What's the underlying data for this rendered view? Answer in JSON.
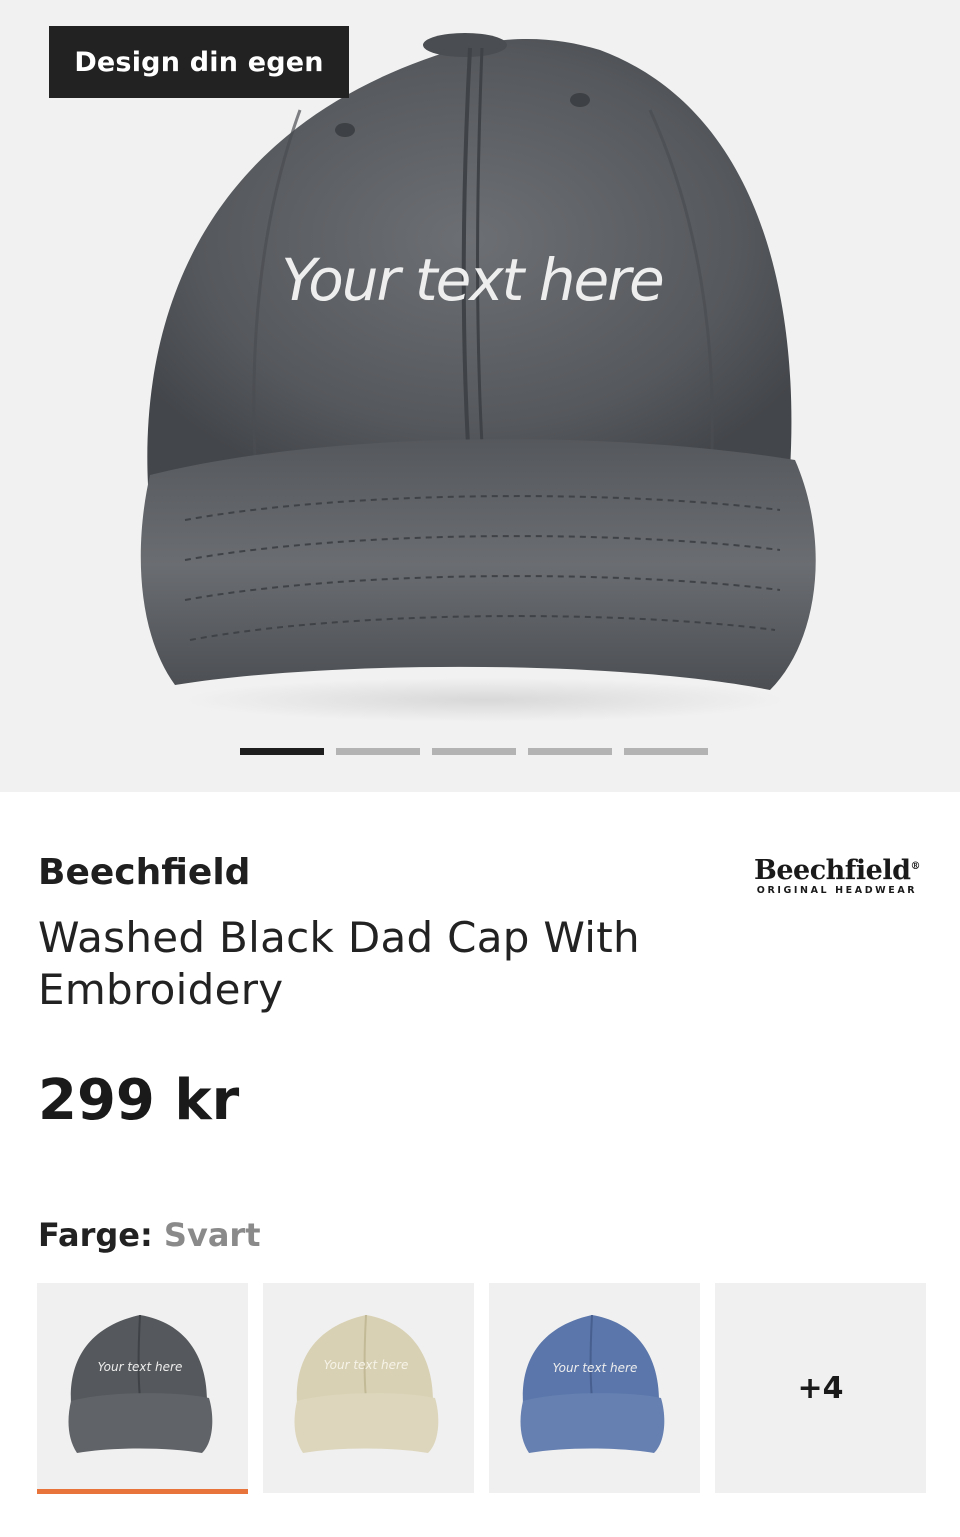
{
  "hero": {
    "badge": "Design din egen",
    "cap_text": "Your text here",
    "image": "washed-black-cap",
    "carousel": {
      "total": 5,
      "active": 1
    }
  },
  "product": {
    "brand": "Beechfield",
    "brand_logo": {
      "main": "Beechfield",
      "registered": "®",
      "sub": "ORIGINAL HEADWEAR"
    },
    "title": "Washed Black Dad Cap With Embroidery",
    "price": "299 kr"
  },
  "color": {
    "label": "Farge:",
    "value": "Svart",
    "swatches": [
      {
        "name": "Svart",
        "cap_color": "#55585c",
        "text": "Your text here",
        "selected": true
      },
      {
        "name": "Beige",
        "cap_color": "#d9d1b4",
        "text": "Your text here",
        "selected": false
      },
      {
        "name": "Blå",
        "cap_color": "#5b76aa",
        "text": "Your text here",
        "selected": false
      }
    ],
    "more_label": "+4",
    "accent": "#e8743b"
  }
}
